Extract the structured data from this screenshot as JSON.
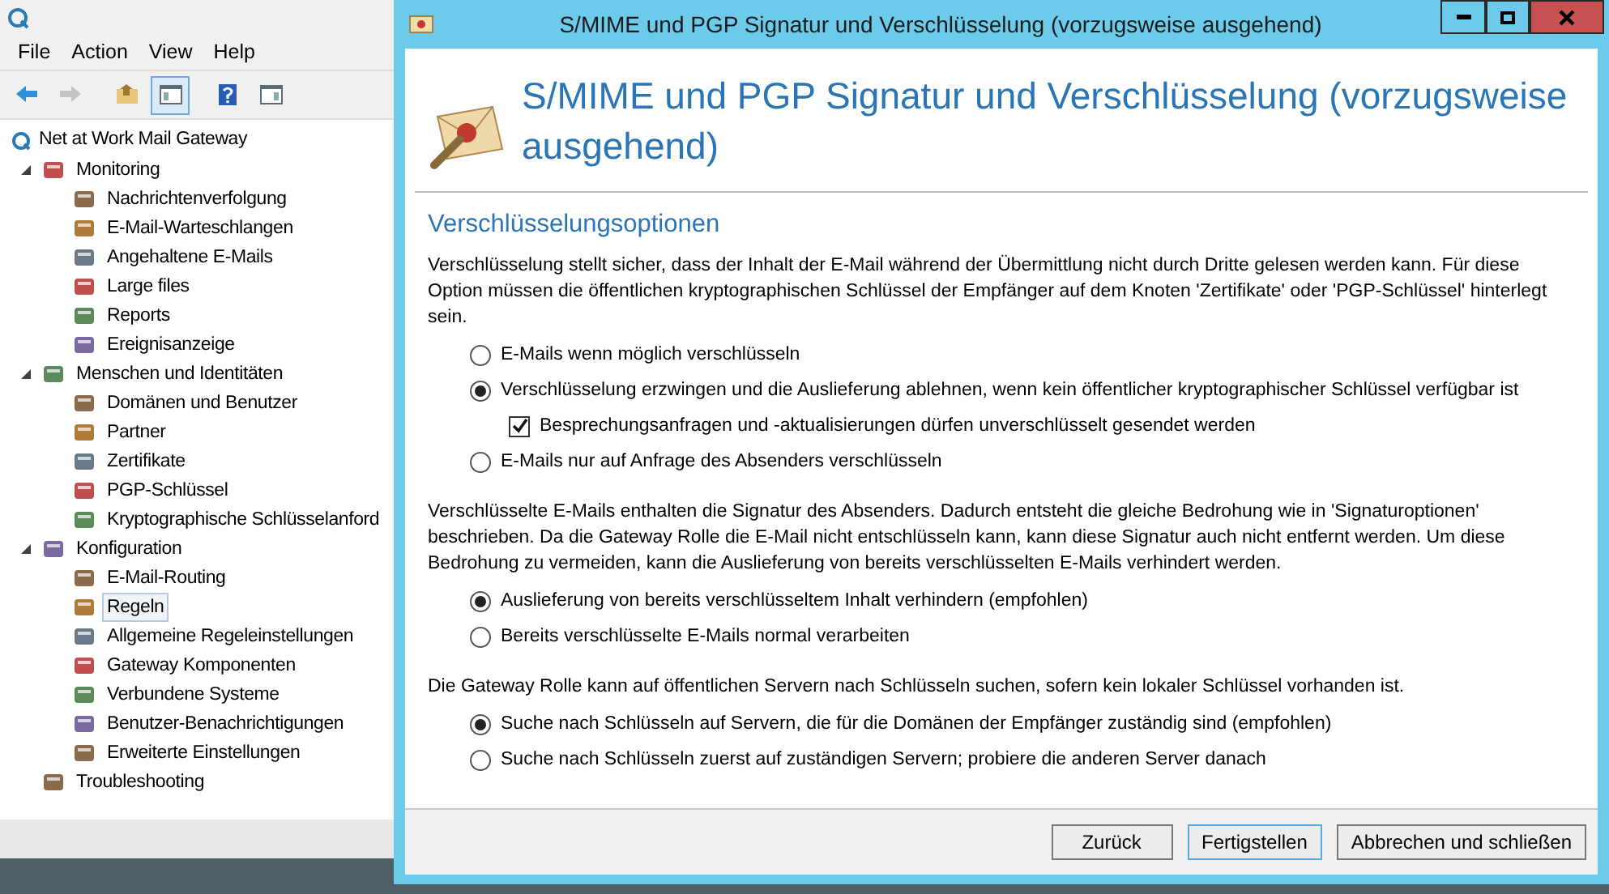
{
  "console": {
    "menu": [
      "File",
      "Action",
      "View",
      "Help"
    ],
    "toolbar": [
      {
        "kind": "back",
        "disabled": false,
        "pressed": false
      },
      {
        "kind": "forward",
        "disabled": true,
        "pressed": false
      },
      {
        "kind": "up",
        "disabled": false,
        "pressed": false
      },
      {
        "kind": "tree",
        "disabled": false,
        "pressed": true
      },
      {
        "kind": "help",
        "disabled": false,
        "pressed": false
      },
      {
        "kind": "action",
        "disabled": false,
        "pressed": false
      }
    ],
    "tree": {
      "label": "Net at Work Mail Gateway",
      "children": [
        {
          "label": "Monitoring",
          "expanded": true,
          "selected": false,
          "children": [
            {
              "label": "Nachrichtenverfolgung",
              "selected": false
            },
            {
              "label": "E-Mail-Warteschlangen",
              "selected": false
            },
            {
              "label": "Angehaltene E-Mails",
              "selected": false
            },
            {
              "label": "Large files",
              "selected": false
            },
            {
              "label": "Reports",
              "selected": false
            },
            {
              "label": "Ereignisanzeige",
              "selected": false
            }
          ]
        },
        {
          "label": "Menschen und Identitäten",
          "expanded": true,
          "selected": false,
          "children": [
            {
              "label": "Domänen und Benutzer",
              "selected": false
            },
            {
              "label": "Partner",
              "selected": false
            },
            {
              "label": "Zertifikate",
              "selected": false
            },
            {
              "label": "PGP-Schlüssel",
              "selected": false
            },
            {
              "label": "Kryptographische Schlüsselanford",
              "selected": false
            }
          ]
        },
        {
          "label": "Konfiguration",
          "expanded": true,
          "selected": false,
          "children": [
            {
              "label": "E-Mail-Routing",
              "selected": false
            },
            {
              "label": "Regeln",
              "selected": true
            },
            {
              "label": "Allgemeine Regeleinstellungen",
              "selected": false
            },
            {
              "label": "Gateway Komponenten",
              "selected": false
            },
            {
              "label": "Verbundene Systeme",
              "selected": false
            },
            {
              "label": "Benutzer-Benachrichtigungen",
              "selected": false
            },
            {
              "label": "Erweiterte Einstellungen",
              "selected": false
            }
          ]
        },
        {
          "label": "Troubleshooting",
          "selected": false
        }
      ]
    }
  },
  "dialog": {
    "window_title": "S/MIME und PGP Signatur und Verschlüsselung (vorzugsweise ausgehend)",
    "heading": "S/MIME und PGP Signatur und Verschlüsselung (vorzugsweise ausgehend)",
    "section": "Verschlüsselungsoptionen",
    "blocks": [
      {
        "kind": "text",
        "text": "Verschlüsselung stellt sicher, dass der Inhalt der E-Mail während der Übermittlung nicht durch Dritte gelesen werden kann. Für diese Option müssen die öffentlichen kryptographischen Schlüssel der Empfänger auf dem Knoten 'Zertifikate' oder 'PGP-Schlüssel' hinterlegt sein."
      },
      {
        "kind": "radio",
        "label": "E-Mails wenn möglich verschlüsseln",
        "selected": false
      },
      {
        "kind": "radio",
        "label": "Verschlüsselung erzwingen und die Auslieferung ablehnen, wenn kein öffentlicher kryptographischer Schlüssel verfügbar ist",
        "selected": true
      },
      {
        "kind": "checkbox",
        "label": "Besprechungsanfragen und -aktualisierungen dürfen unverschlüsselt gesendet werden",
        "checked": true
      },
      {
        "kind": "radio",
        "label": "E-Mails nur auf Anfrage des Absenders verschlüsseln",
        "selected": false
      },
      {
        "kind": "text",
        "text": "Verschlüsselte E-Mails enthalten die Signatur des Absenders. Dadurch entsteht die gleiche Bedrohung wie in 'Signaturoptionen' beschrieben. Da die Gateway Rolle die E-Mail nicht entschlüsseln kann, kann diese Signatur auch nicht entfernt werden. Um diese Bedrohung zu vermeiden, kann die Auslieferung von bereits verschlüsselten E-Mails verhindert werden."
      },
      {
        "kind": "radio",
        "label": "Auslieferung von bereits verschlüsseltem Inhalt verhindern (empfohlen)",
        "selected": true
      },
      {
        "kind": "radio",
        "label": "Bereits verschlüsselte E-Mails normal verarbeiten",
        "selected": false
      },
      {
        "kind": "text",
        "text": "Die Gateway Rolle kann auf öffentlichen Servern nach Schlüsseln suchen, sofern kein lokaler Schlüssel vorhanden ist."
      },
      {
        "kind": "radio",
        "label": "Suche nach Schlüsseln auf Servern, die für die Domänen der Empfänger zuständig sind (empfohlen)",
        "selected": true
      },
      {
        "kind": "radio",
        "label": "Suche nach Schlüsseln zuerst auf zuständigen Servern; probiere die anderen Server danach",
        "selected": false
      }
    ],
    "buttons": [
      "Zurück",
      "Fertigstellen",
      "Abbrechen und schließen"
    ]
  }
}
